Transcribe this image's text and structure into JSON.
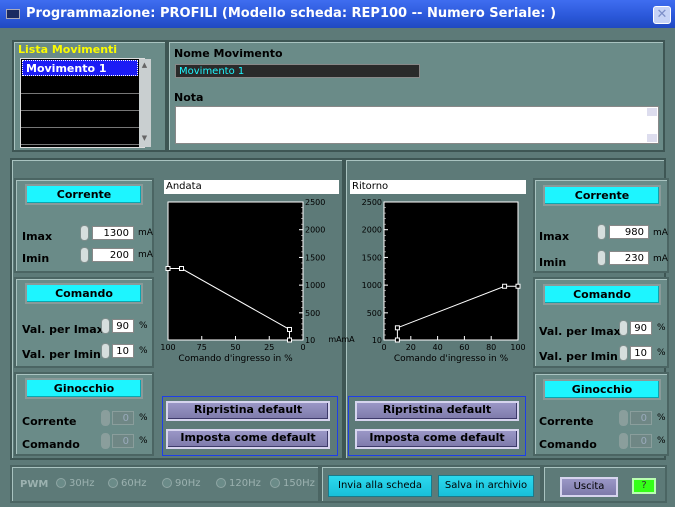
{
  "window": {
    "title": "Programmazione: PROFILI (Modello scheda: REP100 -- Numero Seriale: )",
    "close": "✕"
  },
  "lista": {
    "label": "Lista Movimenti",
    "items": [
      "Movimento 1"
    ]
  },
  "nome": {
    "label": "Nome Movimento",
    "value": "Movimento 1"
  },
  "nota": {
    "label": "Nota",
    "value": ""
  },
  "left": {
    "corrente": {
      "header": "Corrente",
      "imax_label": "Imax",
      "imax": "1300",
      "imin_label": "Imin",
      "imin": "200",
      "unit": "mA"
    },
    "comando": {
      "header": "Comando",
      "vmax_label": "Val. per Imax",
      "vmax": "90",
      "vmin_label": "Val. per Imin",
      "vmin": "10",
      "unit": "%"
    },
    "ginocchio": {
      "header": "Ginocchio",
      "corr_label": "Corrente",
      "corr": "0",
      "com_label": "Comando",
      "com": "0",
      "unit": "%"
    }
  },
  "right": {
    "corrente": {
      "header": "Corrente",
      "imax_label": "Imax",
      "imax": "980",
      "imin_label": "Imin",
      "imin": "230",
      "unit": "mA"
    },
    "comando": {
      "header": "Comando",
      "vmax_label": "Val. per Imax",
      "vmax": "90",
      "vmin_label": "Val. per Imin",
      "vmin": "10",
      "unit": "%"
    },
    "ginocchio": {
      "header": "Ginocchio",
      "corr_label": "Corrente",
      "corr": "0",
      "com_label": "Comando",
      "com": "0",
      "unit": "%"
    }
  },
  "charts": {
    "andata": {
      "title": "Andata",
      "xlabel": "Comando d'ingresso in %",
      "yunit": "mA",
      "xticks": [
        "100",
        "75",
        "50",
        "25",
        "0"
      ],
      "yticks": [
        "2500",
        "2000",
        "1500",
        "1000",
        "500",
        "10"
      ]
    },
    "ritorno": {
      "title": "Ritorno",
      "xlabel": "Comando d'ingresso in %",
      "yunit": "mA",
      "xticks": [
        "0",
        "20",
        "40",
        "60",
        "80",
        "100"
      ],
      "yticks": [
        "2500",
        "2000",
        "1500",
        "1000",
        "500",
        "10"
      ]
    }
  },
  "chart_data": [
    {
      "type": "line",
      "title": "Andata",
      "xlabel": "Comando d'ingresso in %",
      "ylabel": "mA",
      "xlim": [
        100,
        0
      ],
      "ylim": [
        10,
        2500
      ],
      "series": [
        {
          "x": [
            100,
            90,
            10,
            10
          ],
          "y": [
            1300,
            1300,
            200,
            10
          ]
        }
      ]
    },
    {
      "type": "line",
      "title": "Ritorno",
      "xlabel": "Comando d'ingresso in %",
      "ylabel": "mA",
      "xlim": [
        0,
        100
      ],
      "ylim": [
        10,
        2500
      ],
      "series": [
        {
          "x": [
            10,
            10,
            90,
            100
          ],
          "y": [
            10,
            230,
            980,
            980
          ]
        }
      ]
    }
  ],
  "buttons": {
    "ripristina": "Ripristina default",
    "imposta": "Imposta come default",
    "invia": "Invia alla scheda",
    "salva": "Salva in archivio",
    "uscita": "Uscita",
    "help": "?"
  },
  "pwm": {
    "label": "PWM",
    "options": [
      "30Hz",
      "60Hz",
      "90Hz",
      "120Hz",
      "150Hz"
    ]
  }
}
